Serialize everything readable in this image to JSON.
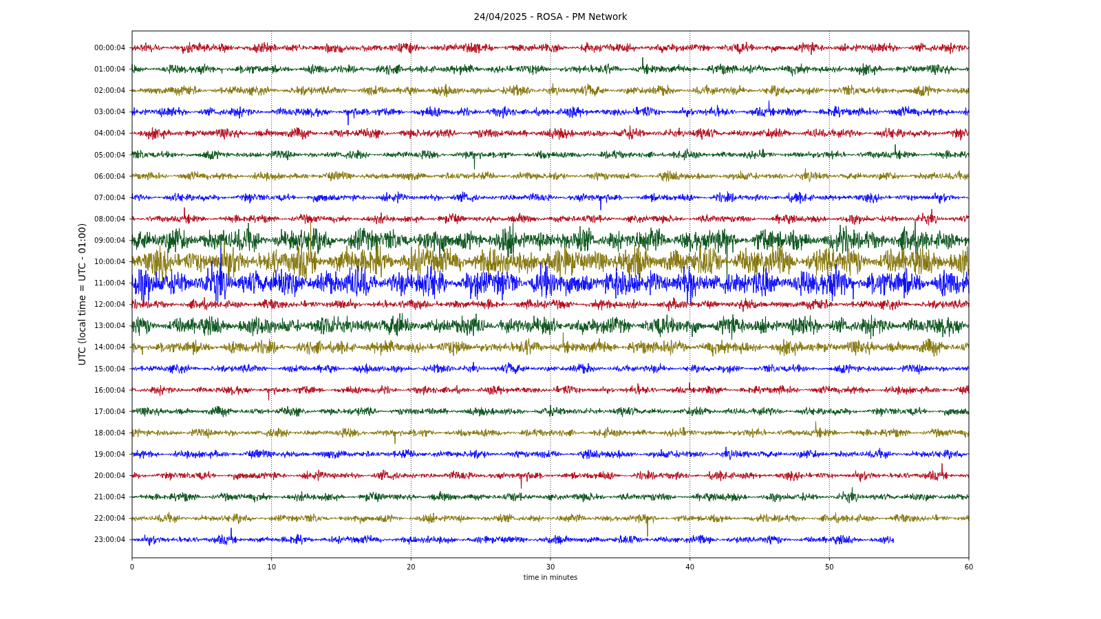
{
  "title": "24/04/2025 - ROSA - PM Network",
  "ylabel": "UTC (local time = UTC - 01:00)",
  "xlabel": "time in minutes",
  "xticks": [
    "0",
    "10",
    "20",
    "30",
    "40",
    "50",
    "60"
  ],
  "traces": [
    {
      "label": "00:00:04",
      "color": "#b00010",
      "level": 1
    },
    {
      "label": "01:00:04",
      "color": "#004d12",
      "level": 1
    },
    {
      "label": "02:00:04",
      "color": "#807000",
      "level": 1
    },
    {
      "label": "03:00:04",
      "color": "#0000ff",
      "level": 1
    },
    {
      "label": "04:00:04",
      "color": "#b00010",
      "level": 1
    },
    {
      "label": "05:00:04",
      "color": "#004d12",
      "level": 1
    },
    {
      "label": "06:00:04",
      "color": "#807000",
      "level": 1
    },
    {
      "label": "07:00:04",
      "color": "#0000ff",
      "level": 1
    },
    {
      "label": "08:00:04",
      "color": "#b00010",
      "level": 1
    },
    {
      "label": "09:00:04",
      "color": "#004d12",
      "level": 1
    },
    {
      "label": "10:00:04",
      "color": "#807000",
      "level": 1
    },
    {
      "label": "11:00:04",
      "color": "#0000ff",
      "level": 1
    },
    {
      "label": "12:00:04",
      "color": "#b00010",
      "level": 1
    },
    {
      "label": "13:00:04",
      "color": "#004d12",
      "level": 1
    },
    {
      "label": "14:00:04",
      "color": "#807000",
      "level": 1
    },
    {
      "label": "15:00:04",
      "color": "#0000ff",
      "level": 1
    },
    {
      "label": "16:00:04",
      "color": "#b00010",
      "level": 1
    },
    {
      "label": "17:00:04",
      "color": "#004d12",
      "level": 1
    },
    {
      "label": "18:00:04",
      "color": "#807000",
      "level": 1
    },
    {
      "label": "19:00:04",
      "color": "#0000ff",
      "level": 1
    },
    {
      "label": "20:00:04",
      "color": "#b00010",
      "level": 1
    },
    {
      "label": "21:00:04",
      "color": "#004d12",
      "level": 1
    },
    {
      "label": "22:00:04",
      "color": "#807000",
      "level": 1
    },
    {
      "label": "23:00:04",
      "color": "#0000ff",
      "level": 0.91
    }
  ]
}
